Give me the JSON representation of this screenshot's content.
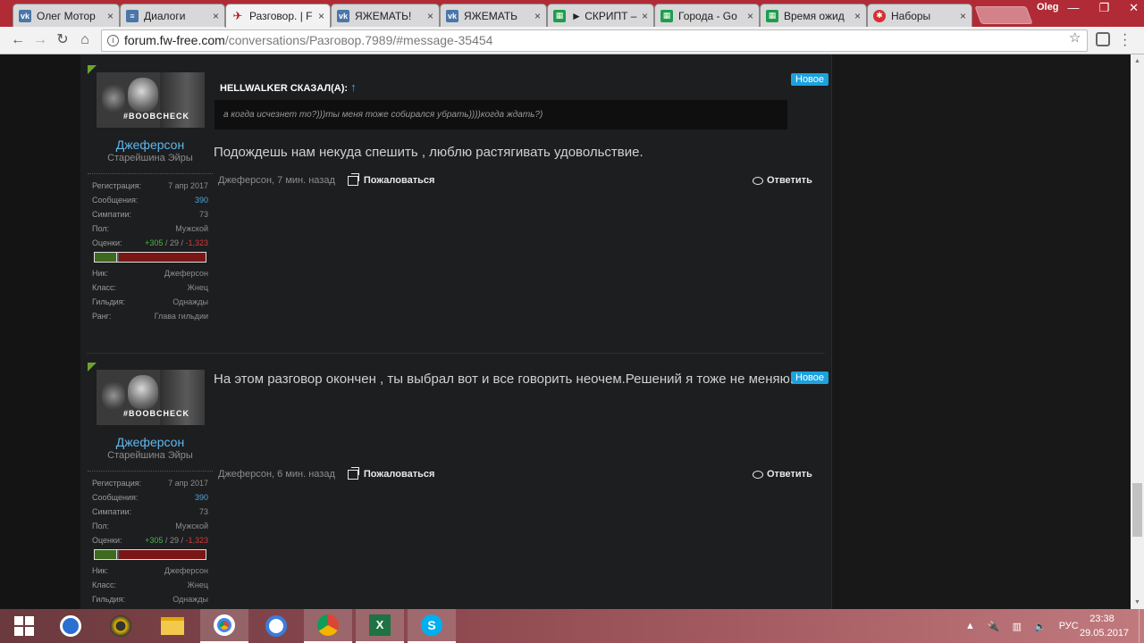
{
  "browser": {
    "tabs": [
      {
        "label": "Олег Мотор",
        "icon": "vk-icon",
        "color": "#4a76a8",
        "active": false
      },
      {
        "label": "Диалоги",
        "icon": "chat-icon",
        "color": "#4a76a8",
        "active": false
      },
      {
        "label": "Разговор. | F",
        "icon": "fw-logo-icon",
        "color": "#a82020",
        "active": true
      },
      {
        "label": "ЯЖЕМАТЬ!",
        "icon": "vk-icon",
        "color": "#4a76a8",
        "active": false
      },
      {
        "label": "ЯЖЕМАТЬ",
        "icon": "vk-icon",
        "color": "#4a76a8",
        "active": false
      },
      {
        "label": "► СКРИПТ –",
        "icon": "sheets-icon",
        "color": "#1e9e4a",
        "active": false
      },
      {
        "label": "Города - Go",
        "icon": "sheets-icon",
        "color": "#1e9e4a",
        "active": false
      },
      {
        "label": "Время ожид",
        "icon": "sheets-icon",
        "color": "#1e9e4a",
        "active": false
      },
      {
        "label": "Наборы",
        "icon": "app-icon",
        "color": "#d63030",
        "active": false
      }
    ],
    "profile_name": "Oleg",
    "url_host": "forum.fw-free.com",
    "url_path": "/conversations/Разговор.7989/#message-35454"
  },
  "user": {
    "name": "Джеферсон",
    "title": "Старейшина Эйры",
    "avatar_tag": "#BOOBCHECK",
    "stats": {
      "reg_label": "Регистрация:",
      "reg_value": "7 апр 2017",
      "msgs_label": "Сообщения:",
      "msgs_value": "390",
      "likes_label": "Симпатии:",
      "likes_value": "73",
      "gender_label": "Пол:",
      "gender_value": "Мужской",
      "ratings_label": "Оценки:",
      "ratings_pos": "+305",
      "ratings_neu": "29",
      "ratings_neg": "-1,323",
      "rating_positive_share": 0.2,
      "nick_label": "Ник:",
      "nick_value": "Джеферсон",
      "class_label": "Класс:",
      "class_value": "Жнец",
      "guild_label": "Гильдия:",
      "guild_value": "Однажды",
      "rank_label": "Ранг:",
      "rank_value": "Глава гильдии"
    }
  },
  "messages": [
    {
      "badge": "Новое",
      "quote_author": "HELLWALKER СКАЗАЛ(А):",
      "quote_arrow": "↑",
      "quote_text": "а когда исчезнет то?)))ты меня тоже собирался убрать))))когда ждать?)",
      "text": "Подождешь нам некуда спешить , люблю растягивать удовольствие.",
      "meta": "Джеферсон, 7 мин. назад",
      "report_label": "Пожаловаться",
      "reply_label": "Ответить"
    },
    {
      "badge": "Новое",
      "text": "На этом разговор окончен , ты выбрал вот и все говорить неочем.Решений я тоже не меняю.",
      "meta": "Джеферсон, 6 мин. назад",
      "report_label": "Пожаловаться",
      "reply_label": "Ответить"
    }
  ],
  "taskbar": {
    "apps": [
      "start",
      "teamviewer-like",
      "media-player",
      "file-explorer",
      "chrome",
      "browser-2",
      "chrome-alert",
      "excel",
      "skype"
    ],
    "lang": "РУС",
    "time": "23:38",
    "date": "29.05.2017"
  }
}
